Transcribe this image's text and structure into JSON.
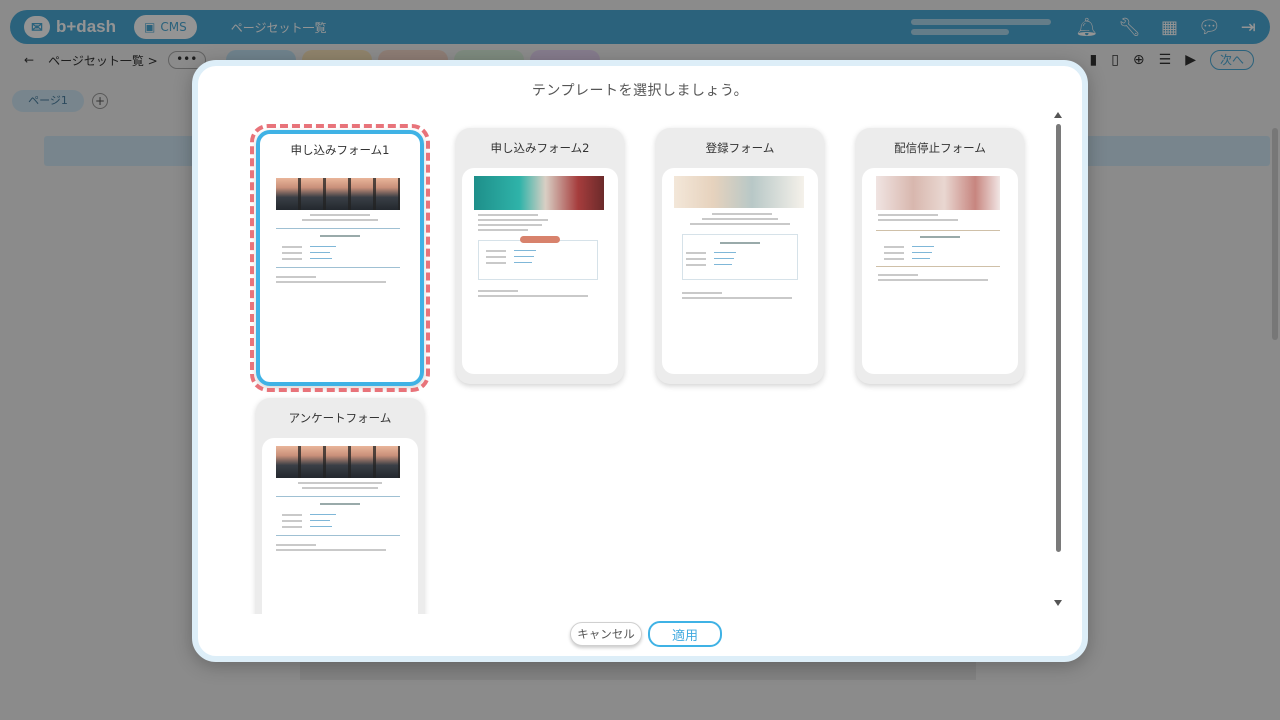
{
  "app": {
    "logo_text": "b+dash",
    "cms_label": "CMS",
    "title": "ページセット一覧",
    "icons": [
      "bell-icon",
      "wrench-icon",
      "grid-icon",
      "chat-icon",
      "logout-icon"
    ]
  },
  "subbar": {
    "back": "←",
    "breadcrumb": "ページセット一覧 >",
    "more": "•••",
    "next_label": "次へ"
  },
  "page_tab": {
    "label": "ページ1",
    "add": "+"
  },
  "modal": {
    "title": "テンプレートを選択しましょう。",
    "templates": [
      {
        "title": "申し込みフォーム1",
        "selected": true
      },
      {
        "title": "申し込みフォーム2",
        "selected": false
      },
      {
        "title": "登録フォーム",
        "selected": false
      },
      {
        "title": "配信停止フォーム",
        "selected": false
      },
      {
        "title": "アンケートフォーム",
        "selected": false
      }
    ],
    "cancel_label": "キャンセル",
    "apply_label": "適用"
  },
  "colors": {
    "accent": "#3fb2e5",
    "selection_dash": "#e8737a",
    "topbar": "#4aa9d6"
  }
}
